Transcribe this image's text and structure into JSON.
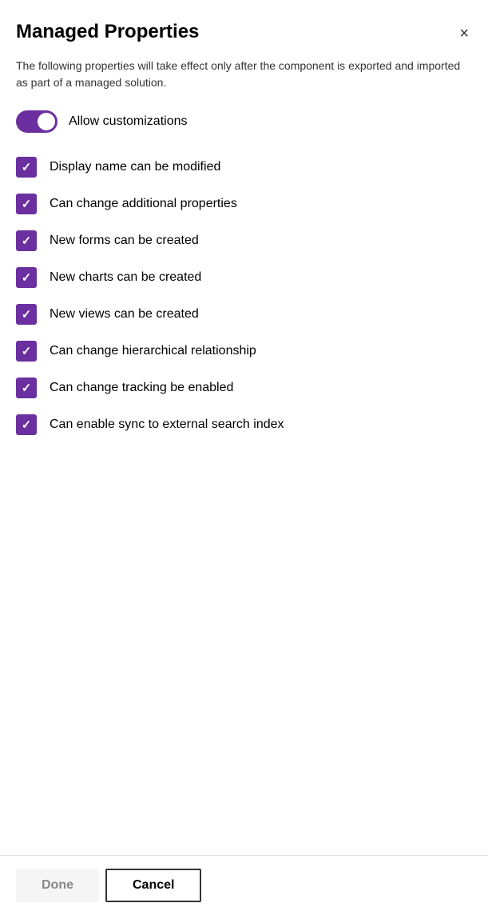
{
  "dialog": {
    "title": "Managed Properties",
    "description": "The following properties will take effect only after the component is exported and imported as part of a managed solution.",
    "close_label": "×"
  },
  "toggle": {
    "label": "Allow customizations",
    "checked": true
  },
  "checkboxes": [
    {
      "label": "Display name can be modified",
      "checked": true
    },
    {
      "label": "Can change additional properties",
      "checked": true
    },
    {
      "label": "New forms can be created",
      "checked": true
    },
    {
      "label": "New charts can be created",
      "checked": true
    },
    {
      "label": "New views can be created",
      "checked": true
    },
    {
      "label": "Can change hierarchical relationship",
      "checked": true
    },
    {
      "label": "Can change tracking be enabled",
      "checked": true
    },
    {
      "label": "Can enable sync to external search index",
      "checked": true
    }
  ],
  "footer": {
    "done_label": "Done",
    "cancel_label": "Cancel"
  }
}
